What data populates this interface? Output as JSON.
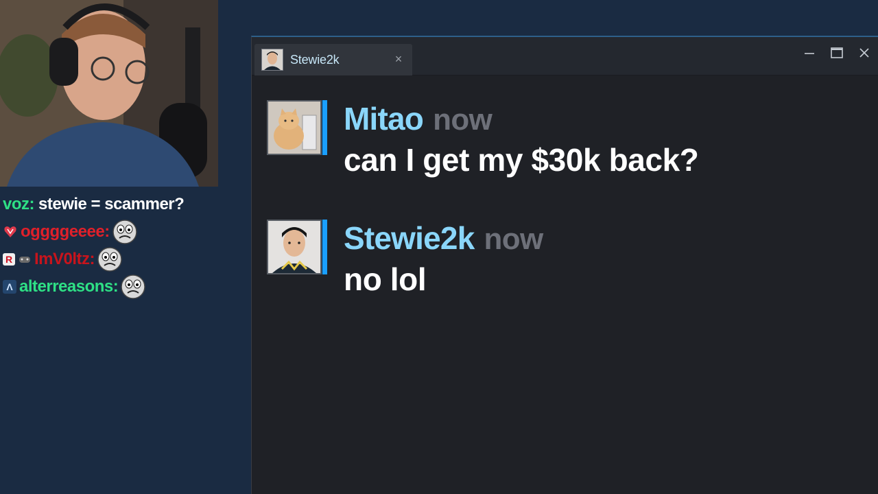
{
  "stream_chat": {
    "lines": [
      {
        "user": "voz:",
        "user_color": "#2ee085",
        "message": "stewie = scammer?",
        "badges": [],
        "emote": ""
      },
      {
        "user": "oggggeeee:",
        "user_color": "#e0202a",
        "message": "",
        "badges": [
          "heart-badge-icon"
        ],
        "emote": "worried-face-emote"
      },
      {
        "user": "ImV0ltz:",
        "user_color": "#c8141c",
        "message": "",
        "badges": [
          "r-badge-icon",
          "controller-badge-icon"
        ],
        "emote": "worried-face-emote"
      },
      {
        "user": "alterreasons:",
        "user_color": "#2ee085",
        "message": "",
        "badges": [
          "a-badge-icon"
        ],
        "emote": "worried-face-emote"
      }
    ]
  },
  "steam_chat": {
    "tab_label": "Stewie2k",
    "tab_close": "×",
    "window_controls": {
      "minimize": "—",
      "maximize": "☐",
      "close": "✕"
    },
    "accent_color": "#1a9fff",
    "messages": [
      {
        "name": "Mitao",
        "time": "now",
        "text": "can I get my $30k back?",
        "avatar": "cat-avatar"
      },
      {
        "name": "Stewie2k",
        "time": "now",
        "text": "no lol",
        "avatar": "stewie2k-avatar"
      }
    ]
  }
}
